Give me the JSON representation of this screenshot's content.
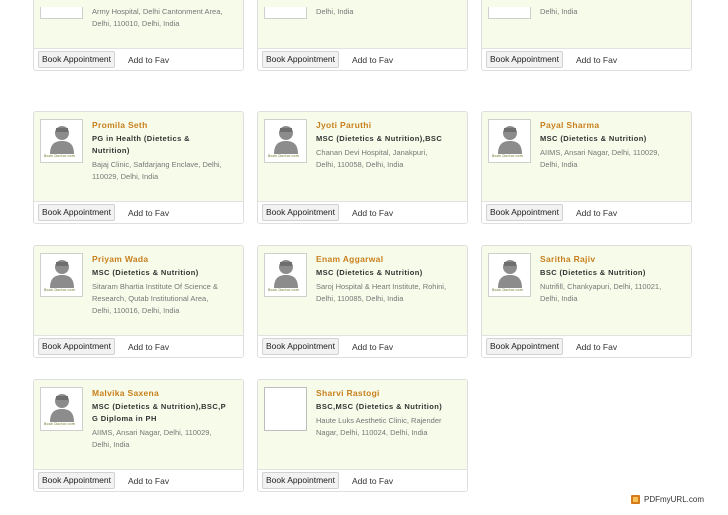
{
  "actions": {
    "book_label": "Book Appointment",
    "fav_label": "Add to Fav"
  },
  "placeholder_logo_text": "Book Doctor.com",
  "partial_row": [
    {
      "address_lines": [
        "Army Hospital, Delhi Cantonment Area,",
        "Delhi, 110010, Delhi, India"
      ]
    },
    {
      "address_lines": [
        "Delhi, India"
      ]
    },
    {
      "address_lines": [
        "Delhi, India"
      ]
    }
  ],
  "doctors": [
    {
      "name": "Promila Seth",
      "qualification_lines": [
        "PG in Health (Dietetics &",
        "Nutrition)"
      ],
      "address_lines": [
        "Bajaj Clinic, Safdarjang Enclave, Delhi,",
        "110029, Delhi, India"
      ],
      "photo": "placeholder"
    },
    {
      "name": "Jyoti Paruthi",
      "qualification_lines": [
        "MSC (Dietetics & Nutrition),BSC"
      ],
      "address_lines": [
        "Chanan Devi Hospital, Janakpuri,",
        "Delhi, 110058, Delhi, India"
      ],
      "photo": "placeholder"
    },
    {
      "name": "Payal Sharma",
      "qualification_lines": [
        "MSC (Dietetics & Nutrition)"
      ],
      "address_lines": [
        "AIIMS, Ansari Nagar, Delhi, 110029,",
        "Delhi, India"
      ],
      "photo": "placeholder"
    },
    {
      "name": "Priyam Wada",
      "qualification_lines": [
        "MSC (Dietetics & Nutrition)"
      ],
      "address_lines": [
        "Sitaram Bhartia Institute Of Science &",
        "Research, Qutab Institutional Area,",
        "Delhi, 110016, Delhi, India"
      ],
      "photo": "placeholder"
    },
    {
      "name": "Enam Aggarwal",
      "qualification_lines": [
        "MSC (Dietetics & Nutrition)"
      ],
      "address_lines": [
        "Saroj Hospital & Heart Institute, Rohini,",
        "Delhi, 110085, Delhi, India"
      ],
      "photo": "placeholder"
    },
    {
      "name": "Saritha Rajiv",
      "qualification_lines": [
        "BSC (Dietetics & Nutrition)"
      ],
      "address_lines": [
        "Nutrifill, Chankyapuri, Delhi, 110021,",
        "Delhi, India"
      ],
      "photo": "placeholder"
    },
    {
      "name": "Malvika Saxena",
      "qualification_lines": [
        "MSC (Dietetics & Nutrition),BSC,P",
        "G Diploma in PH"
      ],
      "address_lines": [
        "AIIMS, Ansari Nagar, Delhi, 110029,",
        "Delhi, India"
      ],
      "photo": "placeholder"
    },
    {
      "name": "Sharvi Rastogi",
      "qualification_lines": [
        "BSC,MSC (Dietetics & Nutrition)"
      ],
      "address_lines": [
        "Haute Luks Aesthetic Clinic, Rajender",
        "Nagar, Delhi, 110024, Delhi, India"
      ],
      "photo": "blank"
    }
  ],
  "footer": {
    "brand": "PDFmyURL.com",
    "icon": "pdf-icon"
  }
}
